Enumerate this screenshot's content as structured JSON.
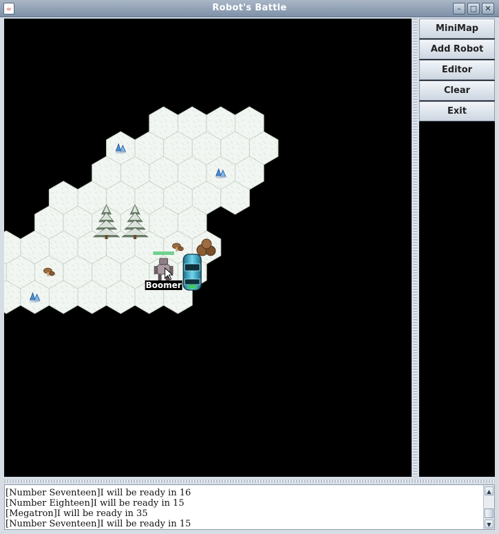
{
  "window": {
    "title": "Robot's Battle",
    "app_icon": "java-cup-icon",
    "controls": [
      "minimize-icon",
      "maximize-icon",
      "close-icon"
    ]
  },
  "game": {
    "background_color": "#000000",
    "hex_grid": {
      "rows": [
        {
          "cols": [
            3,
            4,
            5,
            6
          ]
        },
        {
          "cols": [
            2,
            3,
            4,
            5,
            6,
            7
          ]
        },
        {
          "cols": [
            2,
            3,
            4,
            5,
            6,
            7
          ]
        },
        {
          "cols": [
            1,
            2,
            3,
            4,
            5,
            6,
            7
          ]
        },
        {
          "cols": [
            1,
            2,
            3,
            4,
            5,
            6
          ]
        },
        {
          "cols": [
            0,
            1,
            2,
            3,
            4,
            5,
            6,
            7
          ]
        },
        {
          "cols": [
            0,
            1,
            2,
            3,
            4,
            5,
            6,
            7
          ]
        },
        {
          "cols": [
            0,
            1,
            2,
            3,
            4,
            5,
            6,
            7
          ]
        }
      ]
    },
    "objects": [
      {
        "type": "crystal-icon",
        "row": 1,
        "col": 2
      },
      {
        "type": "crystal-icon",
        "row": 2,
        "col": 6
      },
      {
        "type": "snowy-pine-tree-icon",
        "row": 4,
        "col": 3
      },
      {
        "type": "snowy-pine-tree-icon",
        "row": 4,
        "col": 4
      },
      {
        "type": "mushroom-icon",
        "row": 5,
        "col": 6
      },
      {
        "type": "boulder-pile-icon",
        "row": 5,
        "col": 7
      },
      {
        "type": "mushroom-icon",
        "row": 6,
        "col": 2
      },
      {
        "type": "crystal-icon",
        "row": 7,
        "col": 2
      },
      {
        "type": "energy-tower-icon",
        "row": 6,
        "col": 7
      }
    ],
    "robot": {
      "name": "Boomer",
      "health": 1.0,
      "row": 6,
      "col": 6,
      "icon": "robot-icon"
    },
    "cursor": "mouse-pointer-icon"
  },
  "sidebar": {
    "buttons": [
      {
        "id": "minimap",
        "label": "MiniMap"
      },
      {
        "id": "add-robot",
        "label": "Add Robot"
      },
      {
        "id": "editor",
        "label": "Editor"
      },
      {
        "id": "clear",
        "label": "Clear"
      },
      {
        "id": "exit",
        "label": "Exit"
      }
    ]
  },
  "log": {
    "lines": [
      "[Number Seventeen]I will be ready in 16",
      "[Number Eighteen]I will be ready in 15",
      "[Megatron]I will be ready in 35",
      "[Number Seventeen]I will be ready in 15"
    ]
  }
}
